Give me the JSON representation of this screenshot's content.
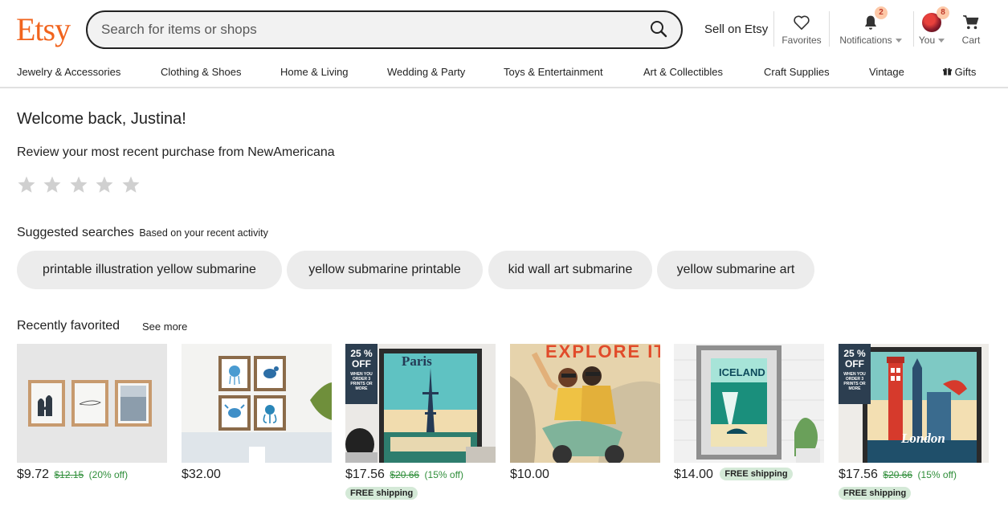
{
  "header": {
    "logo": "Etsy",
    "search_placeholder": "Search for items or shops",
    "sell_label": "Sell on Etsy",
    "favorites_label": "Favorites",
    "notifications_label": "Notifications",
    "notifications_count": "2",
    "you_label": "You",
    "you_count": "8",
    "cart_label": "Cart"
  },
  "categories": [
    "Jewelry & Accessories",
    "Clothing & Shoes",
    "Home & Living",
    "Wedding & Party",
    "Toys & Entertainment",
    "Art & Collectibles",
    "Craft Supplies",
    "Vintage",
    "Gifts"
  ],
  "main": {
    "welcome": "Welcome back, Justina!",
    "review": "Review your most recent purchase from NewAmericana",
    "rating": 0,
    "suggested_title": "Suggested searches",
    "suggested_sub": "Based on your recent activity",
    "suggestions": [
      "printable illustration yellow submarine",
      "yellow submarine printable",
      "kid wall art submarine",
      "yellow submarine art"
    ],
    "recent_title": "Recently favorited",
    "see_more": "See more"
  },
  "products": [
    {
      "price": "$9.72",
      "original": "$12.15",
      "discount": "(20% off)",
      "shipping": ""
    },
    {
      "price": "$32.00",
      "original": "",
      "discount": "",
      "shipping": ""
    },
    {
      "price": "$17.56",
      "original": "$20.66",
      "discount": "(15% off)",
      "shipping": "FREE shipping",
      "sale_big": "25 %\nOFF",
      "sale_small": "WHEN YOU ORDER 3 PRINTS OR MORE",
      "poster_title": "Paris"
    },
    {
      "price": "$10.00",
      "original": "",
      "discount": "",
      "shipping": "",
      "poster_title": "EXPLORE ITALI"
    },
    {
      "price": "$14.00",
      "original": "",
      "discount": "",
      "shipping": "FREE shipping",
      "poster_title": "ICELAND"
    },
    {
      "price": "$17.56",
      "original": "$20.66",
      "discount": "(15% off)",
      "shipping": "FREE shipping",
      "sale_big": "25 %\nOFF",
      "sale_small": "WHEN YOU ORDER 3 PRINTS OR MORE",
      "poster_title": "London"
    }
  ],
  "colors": {
    "brand": "#f1641e",
    "discount_green": "#2f8e3a",
    "shipping_badge_bg": "#d4e9d7",
    "badge_bg": "#fdc9a8",
    "pill_bg": "#ececec"
  }
}
